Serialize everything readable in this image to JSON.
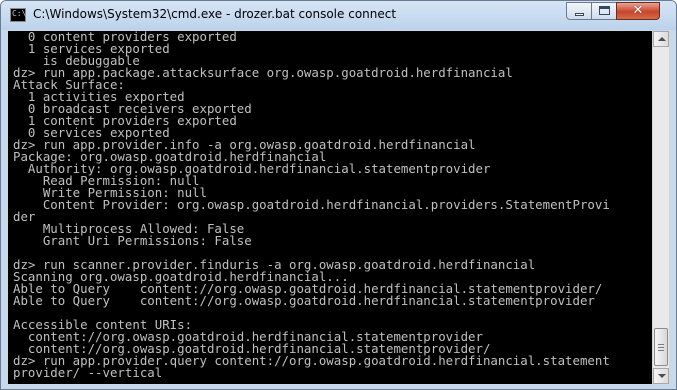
{
  "window": {
    "title": "C:\\Windows\\System32\\cmd.exe - drozer.bat  console connect",
    "icon_label": "C:\\",
    "controls": {
      "minimize_icon": "minimize-icon",
      "maximize_icon": "maximize-icon",
      "close_icon": "close-icon",
      "close_glyph": "✕"
    }
  },
  "console": {
    "background": "#000000",
    "foreground": "#c0c0c0",
    "lines": [
      "  0 content providers exported",
      "  1 services exported",
      "    is debuggable",
      "dz> run app.package.attacksurface org.owasp.goatdroid.herdfinancial",
      "Attack Surface:",
      "  1 activities exported",
      "  0 broadcast receivers exported",
      "  1 content providers exported",
      "  0 services exported",
      "dz> run app.provider.info -a org.owasp.goatdroid.herdfinancial",
      "Package: org.owasp.goatdroid.herdfinancial",
      "  Authority: org.owasp.goatdroid.herdfinancial.statementprovider",
      "    Read Permission: null",
      "    Write Permission: null",
      "    Content Provider: org.owasp.goatdroid.herdfinancial.providers.StatementProvi",
      "der",
      "    Multiprocess Allowed: False",
      "    Grant Uri Permissions: False",
      "",
      "dz> run scanner.provider.finduris -a org.owasp.goatdroid.herdfinancial",
      "Scanning org.owasp.goatdroid.herdfinancial...",
      "Able to Query    content://org.owasp.goatdroid.herdfinancial.statementprovider/",
      "Able to Query    content://org.owasp.goatdroid.herdfinancial.statementprovider",
      "",
      "Accessible content URIs:",
      "  content://org.owasp.goatdroid.herdfinancial.statementprovider",
      "  content://org.owasp.goatdroid.herdfinancial.statementprovider/",
      "dz> run app.provider.query content://org.owasp.goatdroid.herdfinancial.statement",
      "provider/ --vertical"
    ]
  }
}
